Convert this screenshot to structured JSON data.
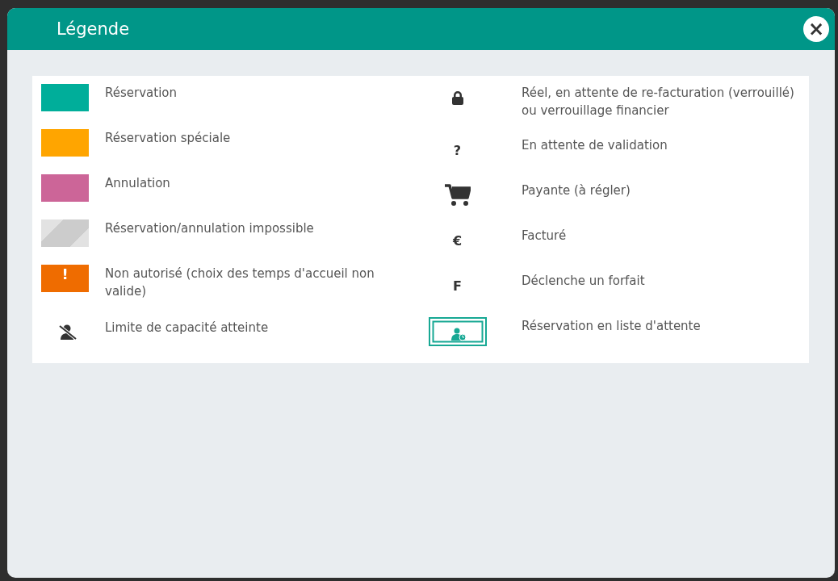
{
  "dialog": {
    "title": "Légende",
    "close": "×"
  },
  "columns": [
    [
      {
        "kind": "swatch",
        "color": "#00ae9a",
        "label": "Réservation"
      },
      {
        "kind": "swatch",
        "color": "#ffa500",
        "label": "Réservation spéciale"
      },
      {
        "kind": "swatch",
        "color": "#cc6598",
        "label": "Annulation"
      },
      {
        "kind": "striped",
        "label": "Réservation/annulation impossible"
      },
      {
        "kind": "alert",
        "color": "#ef6c00",
        "glyph": "!",
        "label": "Non autorisé (choix des temps d'accueil non valide)"
      },
      {
        "kind": "no-person",
        "label": "Limite de capacité atteinte"
      }
    ],
    [
      {
        "kind": "lock",
        "label": "Réel, en attente de re-facturation (verrouillé) ou verrouillage financier"
      },
      {
        "kind": "glyph",
        "glyph": "?",
        "label": "En attente de validation"
      },
      {
        "kind": "cart",
        "label": "Payante (à régler)"
      },
      {
        "kind": "glyph",
        "glyph": "€",
        "label": "Facturé"
      },
      {
        "kind": "glyph",
        "glyph": "F",
        "label": "Déclenche un forfait"
      },
      {
        "kind": "waitlist",
        "label": "Réservation en liste d'attente"
      }
    ]
  ]
}
